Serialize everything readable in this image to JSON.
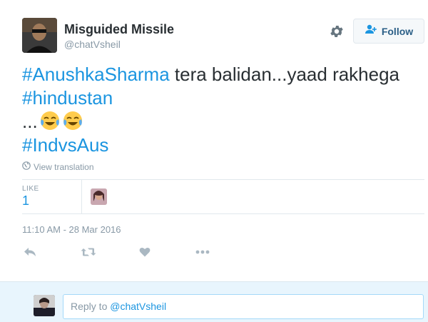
{
  "user": {
    "display_name": "Misguided Missile",
    "handle": "@chatVsheil"
  },
  "follow_button": {
    "label": "Follow"
  },
  "tweet": {
    "hashtag_1": "#AnushkaSharma",
    "text_1": " tera balidan...yaad rakhega ",
    "hashtag_2": "#hindustan",
    "text_2": "...",
    "hashtag_3": "#IndvsAus",
    "emoji_names": [
      "tears-of-joy-emoji",
      "tears-of-joy-emoji"
    ]
  },
  "translation_link": "View translation",
  "stats": {
    "like_label": "LIKE",
    "like_count": "1"
  },
  "timestamp": "11:10 AM - 28 Mar 2016",
  "actions": [
    "reply-icon",
    "retweet-icon",
    "heart-icon",
    "more-icon"
  ],
  "reply": {
    "prefix": "Reply to ",
    "mention": "@chatVsheil"
  },
  "colors": {
    "link": "#1b95e0",
    "text": "#292f33",
    "muted": "#8899a6",
    "reply_bg": "#e8f5fd"
  }
}
